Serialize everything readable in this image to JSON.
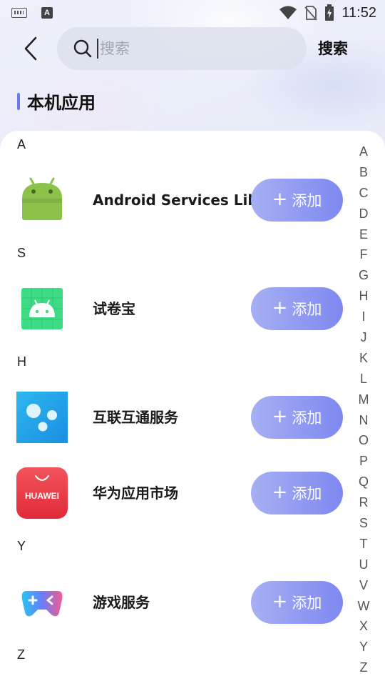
{
  "status_bar": {
    "time": "11:52",
    "left_icons": [
      "keyboard-icon",
      "a-notification-icon"
    ],
    "right_icons": [
      "wifi-icon",
      "no-sim-icon",
      "battery-charging-icon"
    ]
  },
  "header": {
    "search_placeholder": "搜索",
    "search_value": "",
    "search_button": "搜索"
  },
  "section_title": "本机应用",
  "colors": {
    "accent": "#6e78ee",
    "button_gradient_start": "#a7b0f3",
    "button_gradient_end": "#7e88f0"
  },
  "groups": [
    {
      "letter": "A",
      "apps": [
        {
          "name": "Android Services Library",
          "icon": "android-robot-icon",
          "action": "添加",
          "plus": "+"
        }
      ]
    },
    {
      "letter": "S",
      "apps": [
        {
          "name": "试卷宝",
          "icon": "android-green-tile-icon",
          "action": "添加",
          "plus": "+"
        }
      ]
    },
    {
      "letter": "H",
      "apps": [
        {
          "name": "互联互通服务",
          "icon": "interconnect-dots-icon",
          "action": "添加",
          "plus": "+"
        },
        {
          "name": "华为应用市场",
          "icon": "huawei-appgallery-icon",
          "icon_text": "HUAWEI",
          "action": "添加",
          "plus": "+"
        }
      ]
    },
    {
      "letter": "Y",
      "apps": [
        {
          "name": "游戏服务",
          "icon": "gamepad-icon",
          "action": "添加",
          "plus": "+"
        }
      ]
    },
    {
      "letter": "Z",
      "apps": []
    }
  ],
  "alphabet_index": [
    "A",
    "B",
    "C",
    "D",
    "E",
    "F",
    "G",
    "H",
    "I",
    "J",
    "K",
    "L",
    "M",
    "N",
    "O",
    "P",
    "Q",
    "R",
    "S",
    "T",
    "U",
    "V",
    "W",
    "X",
    "Y",
    "Z"
  ]
}
